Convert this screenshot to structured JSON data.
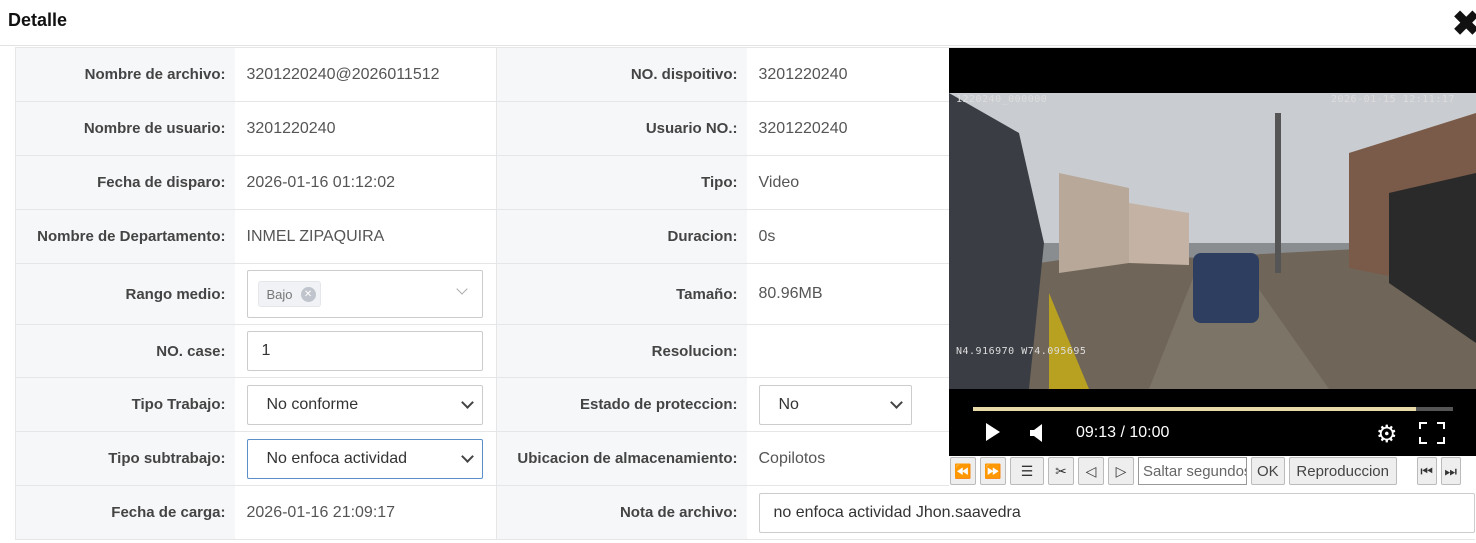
{
  "header": {
    "title": "Detalle",
    "close": "✖"
  },
  "rows": [
    {
      "l1": "Nombre de archivo:",
      "v1": "3201220240@2026011512",
      "l2": "NO. dispoitivo:",
      "v2": "3201220240"
    },
    {
      "l1": "Nombre de usuario:",
      "v1": "3201220240",
      "l2": "Usuario NO.:",
      "v2": "3201220240"
    },
    {
      "l1": "Fecha de disparo:",
      "v1": "2026-01-16 01:12:02",
      "l2": "Tipo:",
      "v2": "Video"
    },
    {
      "l1": "Nombre de Departamento:",
      "v1": "INMEL ZIPAQUIRA",
      "l2": "Duracion:",
      "v2": "0s"
    },
    {
      "l1": "Rango medio:",
      "tag": "Bajo",
      "l2": "Tamaño:",
      "v2": "80.96MB"
    },
    {
      "l1": "NO. case:",
      "input": "1",
      "l2": "Resolucion:",
      "v2": ""
    },
    {
      "l1": "Tipo Trabajo:",
      "select": "No conforme",
      "l2": "Estado de proteccion:",
      "select2": "No"
    },
    {
      "l1": "Tipo subtrabajo:",
      "select": "No enfoca actividad",
      "l2": "Ubicacion de almacenamiento:",
      "v2": "Copilotos"
    },
    {
      "l1": "Fecha de carga:",
      "v1": "2026-01-16 21:09:17",
      "l2": "Nota de archivo:",
      "note": "no enfoca actividad Jhon.saavedra"
    }
  ],
  "video": {
    "osd_left": "1220240_000000",
    "osd_right": "2026-01-15 12:11:17",
    "osd_gps": "N4.916970 W74.095695",
    "time": "09:13 / 10:00",
    "progress": 0.922
  },
  "toolbar": {
    "seek_placeholder": "Saltar segundos",
    "ok": "OK",
    "play_label": "Reproduccion"
  }
}
